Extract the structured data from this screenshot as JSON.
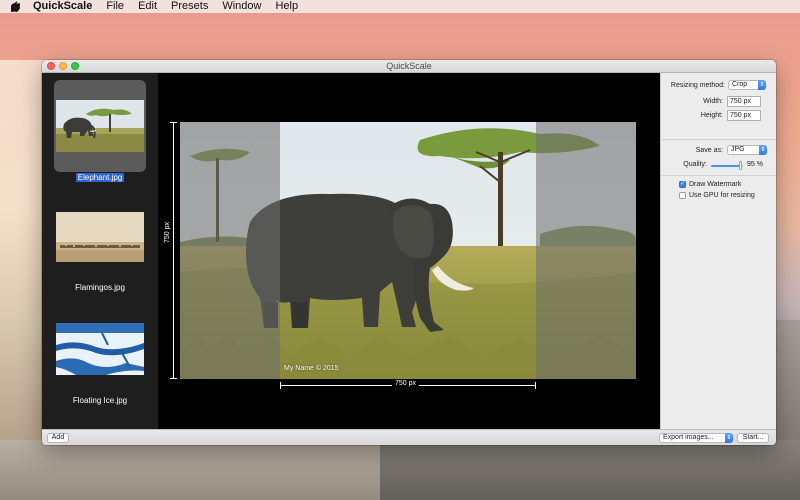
{
  "menubar": {
    "apple_icon": "apple-icon",
    "app_name": "QuickScale",
    "items": [
      "File",
      "Edit",
      "Presets",
      "Window",
      "Help"
    ]
  },
  "window": {
    "title": "QuickScale"
  },
  "sidebar": {
    "items": [
      {
        "label": "Elephant.jpg",
        "selected": true
      },
      {
        "label": "Flamingos.jpg",
        "selected": false
      },
      {
        "label": "Floating Ice.jpg",
        "selected": false
      }
    ],
    "add_label": "Add"
  },
  "canvas": {
    "height_label": "750 px",
    "width_label": "750 px",
    "watermark_text": "My Name © 2015"
  },
  "inspector": {
    "resizing_method_label": "Resizing method:",
    "resizing_method_value": "Crop",
    "width_label": "Width:",
    "width_value": "750 px",
    "height_label": "Height:",
    "height_value": "750 px",
    "save_as_label": "Save as:",
    "save_as_value": "JPG",
    "quality_label": "Quality:",
    "quality_value": "95 %",
    "quality_fraction": 0.95,
    "draw_watermark_label": "Draw Watermark",
    "draw_watermark_checked": true,
    "use_gpu_label": "Use GPU for resizing",
    "use_gpu_checked": false
  },
  "bottombar": {
    "export_label": "Export images...",
    "start_label": "Start..."
  },
  "colors": {
    "selection": "#2f63d3",
    "accent": "#3a84f1",
    "close": "#fc605c",
    "minimize": "#fdbc40",
    "zoom": "#34c84a"
  }
}
